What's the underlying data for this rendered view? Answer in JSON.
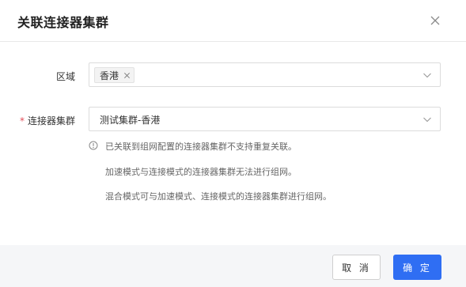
{
  "dialog": {
    "title": "关联连接器集群",
    "close_icon": "close-icon"
  },
  "form": {
    "region": {
      "label": "区域",
      "selected_tag": "香港"
    },
    "cluster": {
      "required_mark": "*",
      "label": "连接器集群",
      "value": "测试集群-香港"
    }
  },
  "hints": {
    "icon": "info-circle-icon",
    "lines": [
      "已关联到组网配置的连接器集群不支持重复关联。",
      "加速模式与连接模式的连接器集群无法进行组网。",
      "混合模式可与加速模式、连接模式的连接器集群进行组网。"
    ]
  },
  "footer": {
    "cancel_label": "取 消",
    "ok_label": "确 定"
  },
  "colors": {
    "primary": "#2f6ef3",
    "required": "#e34d59",
    "footer_bg": "#f5f6f8"
  }
}
